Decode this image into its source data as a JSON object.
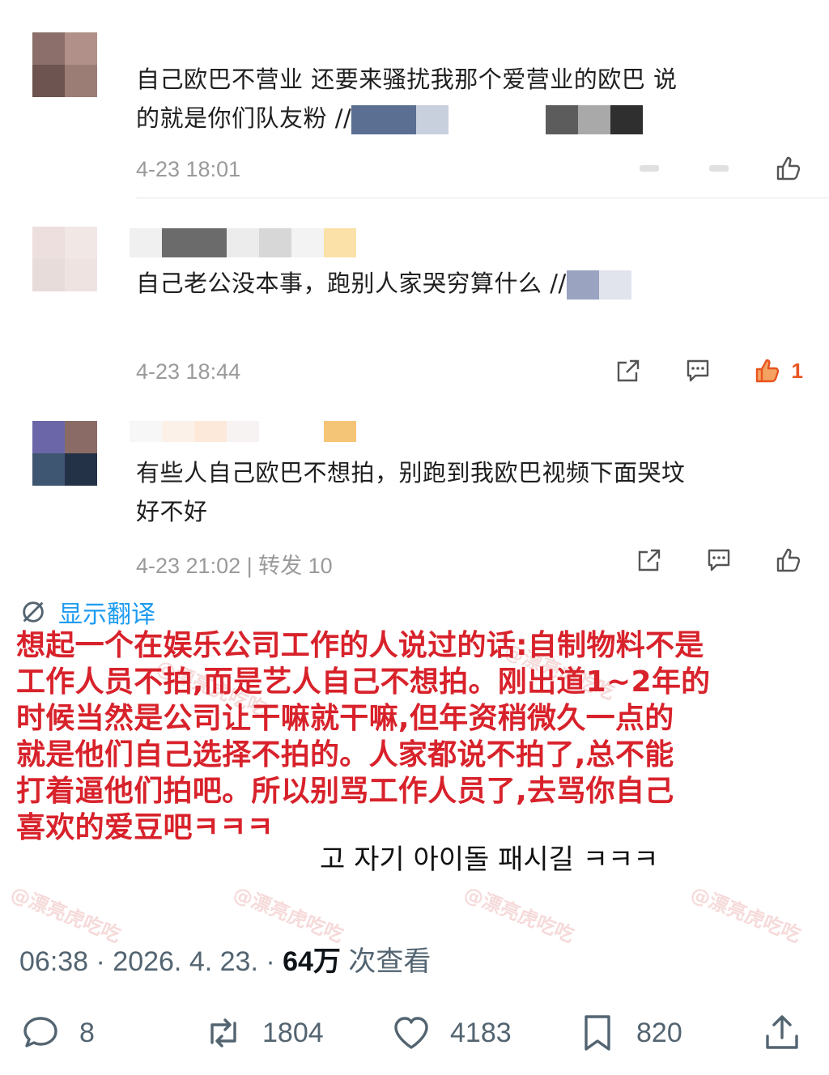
{
  "comments": [
    {
      "text_line1": "自己欧巴不营业 还要来骚扰我那个爱营业的欧巴 说",
      "text_line2": "的就是你们队友粉 //",
      "time": "4-23 18:01"
    },
    {
      "text": "自己老公没本事，跑别人家哭穷算什么 //",
      "time": "4-23 18:44",
      "likes": "1"
    },
    {
      "text_line1": "有些人自己欧巴不想拍，别跑到我欧巴视频下面哭坟",
      "text_line2": "好不好",
      "time": "4-23 21:02",
      "separator": "|",
      "reposts": "转发 10"
    }
  ],
  "translate": {
    "label": "显示翻译"
  },
  "overlay": {
    "lines": [
      "想起一个在娱乐公司工作的人说过的话:自制物料不是",
      "工作人员不拍,而是艺人自己不想拍。刚出道1~2年的",
      "时候当然是公司让干嘛就干嘛,但年资稍微久一点的",
      "就是他们自己选择不拍的。人家都说不拍了,总不能",
      "打着逼他们拍吧。所以别骂工作人员了,去骂你自己",
      "喜欢的爱豆吧ㅋㅋㅋ"
    ],
    "tail": "고 자기 아이돌 패시길 ㅋㅋㅋ"
  },
  "watermark": "@漂亮虎吃吃",
  "stats": {
    "time": "06:38 · 2026. 4. 23. · ",
    "views": "64万",
    "views_label": " 次查看"
  },
  "action_bar": {
    "replies": "8",
    "reposts": "1804",
    "likes": "4183",
    "bookmarks": "820"
  },
  "colors": {
    "accent": "#1d9bf0",
    "overlay_text": "#d8222b",
    "like_active": "#e8541e",
    "meta": "#9a9a9a"
  }
}
